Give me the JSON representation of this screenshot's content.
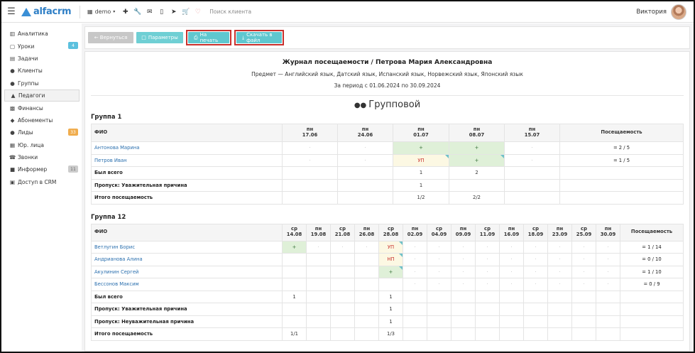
{
  "topbar": {
    "brand": "alfacrm",
    "branch": "demo",
    "search_placeholder": "Поиск клиента",
    "user_name": "Виктория",
    "icons": [
      "plus-icon",
      "wrench-icon",
      "mail-icon",
      "phone-icon",
      "telegram-icon",
      "cart-icon",
      "bell-icon"
    ]
  },
  "sidebar": {
    "items": [
      {
        "label": "Аналитика",
        "icon": "chart-icon",
        "badge": ""
      },
      {
        "label": "Уроки",
        "icon": "calendar-icon",
        "badge": "4"
      },
      {
        "label": "Задачи",
        "icon": "tasks-icon",
        "badge": ""
      },
      {
        "label": "Клиенты",
        "icon": "user-icon",
        "badge": ""
      },
      {
        "label": "Группы",
        "icon": "group-icon",
        "badge": ""
      },
      {
        "label": "Педагоги",
        "icon": "graduation-cap-icon",
        "badge": ""
      },
      {
        "label": "Финансы",
        "icon": "money-icon",
        "badge": ""
      },
      {
        "label": "Абонементы",
        "icon": "tag-icon",
        "badge": ""
      },
      {
        "label": "Лиды",
        "icon": "user-plus-icon",
        "badge": "33"
      },
      {
        "label": "Юр. лица",
        "icon": "building-icon",
        "badge": ""
      },
      {
        "label": "Звонки",
        "icon": "phone-icon",
        "badge": ""
      },
      {
        "label": "Информер",
        "icon": "informer-icon",
        "badge": "11"
      },
      {
        "label": "Доступ в CRM",
        "icon": "lock-icon",
        "badge": ""
      }
    ]
  },
  "toolbar": {
    "back_label": "← Вернуться",
    "params_label": "Параметры",
    "print_label": "На печать",
    "download_label": "Скачать в файл"
  },
  "report": {
    "title": "Журнал посещаемости / Петрова Мария Александровна",
    "subject": "Предмет — Английский язык, Датский язык, Испанский язык, Норвежский язык, Японский язык",
    "period": "За период с 01.06.2024 по 30.09.2024",
    "kind": "Групповой"
  },
  "group1": {
    "title": "Группа 1",
    "col_fio": "ФИО",
    "col_att": "Посещаемость",
    "dates": [
      {
        "dow": "пн",
        "date": "17.06"
      },
      {
        "dow": "пн",
        "date": "24.06"
      },
      {
        "dow": "пн",
        "date": "01.07"
      },
      {
        "dow": "пн",
        "date": "08.07"
      },
      {
        "dow": "пн",
        "date": "15.07"
      }
    ],
    "students": [
      {
        "name": "Антонова Марина",
        "cells": [
          "·",
          "·",
          "+",
          "+",
          "·"
        ],
        "att": "= 2 / 5"
      },
      {
        "name": "Петров Иван",
        "cells": [
          "·",
          "·",
          "УП",
          "+",
          "·"
        ],
        "att": "= 1 / 5"
      }
    ],
    "summary": [
      {
        "label": "Был всего",
        "cells": [
          "",
          "",
          "1",
          "2",
          ""
        ]
      },
      {
        "label": "Пропуск: Уважительная причина",
        "cells": [
          "",
          "",
          "1",
          "",
          ""
        ]
      },
      {
        "label": "Итого посещаемость",
        "cells": [
          "",
          "",
          "1/2",
          "2/2",
          ""
        ]
      }
    ]
  },
  "group12": {
    "title": "Группа 12",
    "col_fio": "ФИО",
    "col_att": "Посещаемость",
    "dates": [
      {
        "dow": "ср",
        "date": "14.08"
      },
      {
        "dow": "пн",
        "date": "19.08"
      },
      {
        "dow": "ср",
        "date": "21.08"
      },
      {
        "dow": "пн",
        "date": "26.08"
      },
      {
        "dow": "ср",
        "date": "28.08"
      },
      {
        "dow": "пн",
        "date": "02.09"
      },
      {
        "dow": "ср",
        "date": "04.09"
      },
      {
        "dow": "пн",
        "date": "09.09"
      },
      {
        "dow": "ср",
        "date": "11.09"
      },
      {
        "dow": "пн",
        "date": "16.09"
      },
      {
        "dow": "ср",
        "date": "18.09"
      },
      {
        "dow": "пн",
        "date": "23.09"
      },
      {
        "dow": "ср",
        "date": "25.09"
      },
      {
        "dow": "пн",
        "date": "30.09"
      }
    ],
    "students": [
      {
        "name": "Ветлугин Борис",
        "cells": [
          "+",
          "·",
          "·",
          "·",
          "УП",
          "·",
          "·",
          "·",
          "·",
          "·",
          "·",
          "·",
          "·",
          "·"
        ],
        "att": "= 1 / 14"
      },
      {
        "name": "Андрианова Алина",
        "cells": [
          "",
          "",
          "",
          "",
          "НП",
          "·",
          "·",
          "·",
          "·",
          "·",
          "·",
          "·",
          "·",
          "·"
        ],
        "att": "= 0 / 10"
      },
      {
        "name": "Акулинин Сергей",
        "cells": [
          "",
          "",
          "",
          "",
          "+",
          "·",
          "·",
          "·",
          "·",
          "·",
          "·",
          "·",
          "·",
          "·"
        ],
        "att": "= 1 / 10"
      },
      {
        "name": "Бессонов Максим",
        "cells": [
          "",
          "",
          "",
          "",
          "",
          "·",
          "·",
          "·",
          "·",
          "·",
          "·",
          "·",
          "·",
          "·"
        ],
        "att": "= 0 / 9"
      }
    ],
    "summary": [
      {
        "label": "Был всего",
        "cells": [
          "1",
          "",
          "",
          "",
          "1",
          "",
          "",
          "",
          "",
          "",
          "",
          "",
          "",
          ""
        ]
      },
      {
        "label": "Пропуск: Уважительная причина",
        "cells": [
          "",
          "",
          "",
          "",
          "1",
          "",
          "",
          "",
          "",
          "",
          "",
          "",
          "",
          ""
        ]
      },
      {
        "label": "Пропуск: Неуважительная причина",
        "cells": [
          "",
          "",
          "",
          "",
          "1",
          "",
          "",
          "",
          "",
          "",
          "",
          "",
          "",
          ""
        ]
      },
      {
        "label": "Итого посещаемость",
        "cells": [
          "1/1",
          "",
          "",
          "",
          "1/3",
          "",
          "",
          "",
          "",
          "",
          "",
          "",
          "",
          ""
        ]
      }
    ]
  }
}
